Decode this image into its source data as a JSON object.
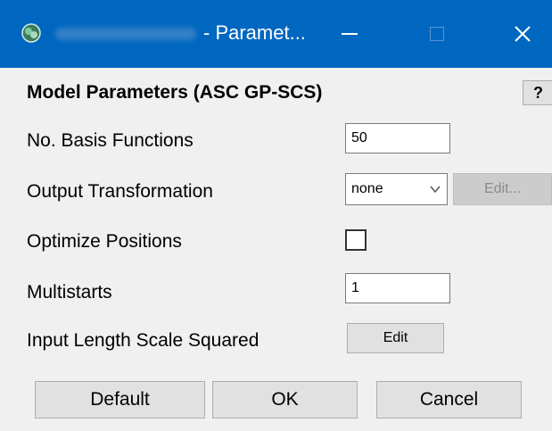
{
  "window": {
    "title": "- Paramet...",
    "icon": "application-icon",
    "controls": {
      "minimize": "minimize-icon",
      "maximize": "maximize-icon",
      "close": "✕"
    },
    "accent_color": "#0067c0"
  },
  "dialog": {
    "heading": "Model Parameters (ASC GP-SCS)",
    "help_label": "?"
  },
  "fields": {
    "basis_functions": {
      "label": "No. Basis Functions",
      "value": "50"
    },
    "output_transformation": {
      "label": "Output Transformation",
      "selected": "none",
      "edit_label": "Edit..."
    },
    "optimize_positions": {
      "label": "Optimize Positions",
      "checked": false
    },
    "multistarts": {
      "label": "Multistarts",
      "value": "1"
    },
    "input_length_scale": {
      "label": "Input Length Scale Squared",
      "edit_label": "Edit"
    }
  },
  "buttons": {
    "default": "Default",
    "ok": "OK",
    "cancel": "Cancel"
  }
}
